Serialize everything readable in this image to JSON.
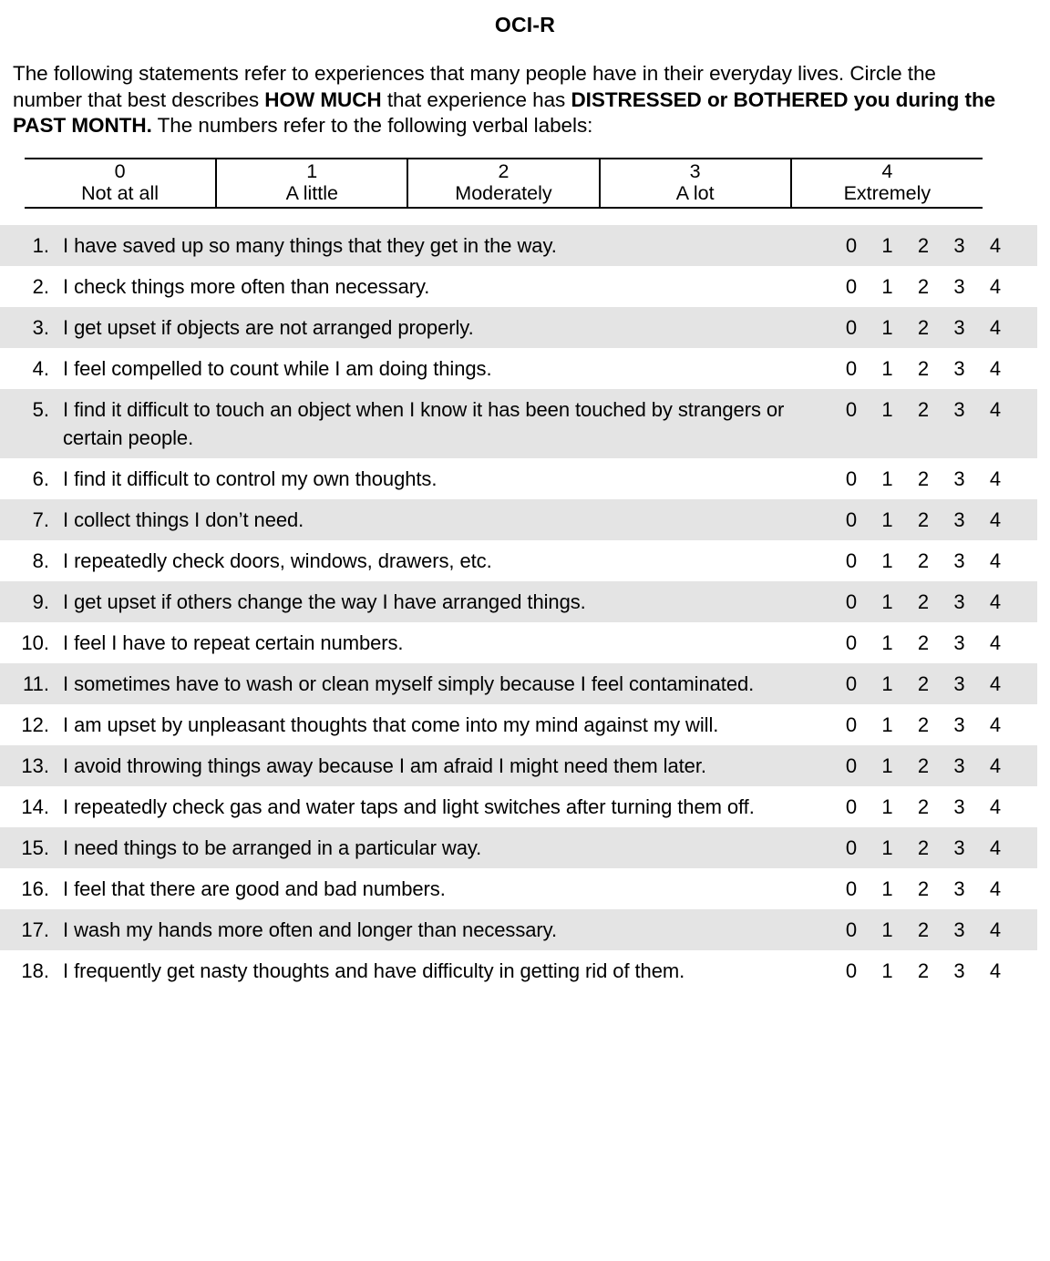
{
  "document": {
    "title": "OCI-R",
    "intro": {
      "segments": [
        {
          "text": "The following statements refer to experiences that many people have in their everyday lives.  Circle the number that best describes ",
          "bold": false
        },
        {
          "text": "HOW MUCH",
          "bold": true
        },
        {
          "text": " that experience has ",
          "bold": false
        },
        {
          "text": "DISTRESSED or BOTHERED you during the PAST MONTH.",
          "bold": true
        },
        {
          "text": " The numbers refer to the following verbal labels:",
          "bold": false
        }
      ]
    }
  },
  "scale": {
    "columns": [
      {
        "number": "0",
        "label": "Not at all"
      },
      {
        "number": "1",
        "label": "A little"
      },
      {
        "number": "2",
        "label": "Moderately"
      },
      {
        "number": "3",
        "label": "A lot"
      },
      {
        "number": "4",
        "label": "Extremely"
      }
    ]
  },
  "response_options": [
    "0",
    "1",
    "2",
    "3",
    "4"
  ],
  "items": [
    {
      "number": "1.",
      "text": "I have saved up so many things that they get in the way."
    },
    {
      "number": "2.",
      "text": "I check things more often than necessary."
    },
    {
      "number": "3.",
      "text": "I get upset if objects are not arranged properly."
    },
    {
      "number": "4.",
      "text": "I feel compelled to count while I am doing things."
    },
    {
      "number": "5.",
      "text": "I find it difficult to touch an object when I know it has been touched by strangers or certain people."
    },
    {
      "number": "6.",
      "text": "I find it difficult to control my own thoughts."
    },
    {
      "number": "7.",
      "text": "I collect things I don’t need."
    },
    {
      "number": "8.",
      "text": "I repeatedly check doors, windows, drawers, etc."
    },
    {
      "number": "9.",
      "text": "I get upset if others change the way I have arranged things."
    },
    {
      "number": "10.",
      "text": "I feel I have to repeat certain numbers."
    },
    {
      "number": "11.",
      "text": "I sometimes have to wash or clean myself simply because I feel contaminated."
    },
    {
      "number": "12.",
      "text": "I am upset by unpleasant thoughts that come into my mind against my will."
    },
    {
      "number": "13.",
      "text": "I avoid throwing things away because I am afraid I might need them later."
    },
    {
      "number": "14.",
      "text": "I repeatedly check gas and water taps and light switches after turning them off."
    },
    {
      "number": "15.",
      "text": "I need things to be arranged in a particular way."
    },
    {
      "number": "16.",
      "text": "I feel that there are good and bad numbers."
    },
    {
      "number": "17.",
      "text": "I wash my hands more often and longer than necessary."
    },
    {
      "number": "18.",
      "text": "I frequently get nasty thoughts and have difficulty in getting rid of them."
    }
  ],
  "style": {
    "shaded_row_color": "#e4e4e4",
    "page_background": "#ffffff",
    "text_color": "#000000"
  }
}
